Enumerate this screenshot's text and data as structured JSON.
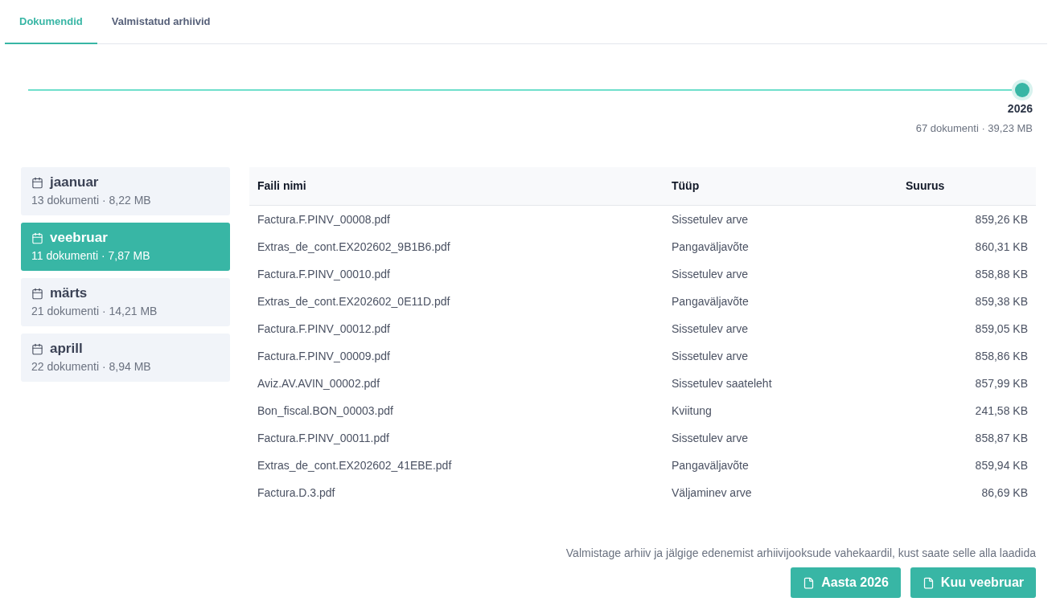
{
  "tabs": [
    {
      "label": "Dokumendid",
      "selected": true
    },
    {
      "label": "Valmistatud arhiivid",
      "selected": false
    }
  ],
  "year_slider": {
    "level": 1,
    "year": "2026",
    "summary": "67 dokumenti · 39,23 MB"
  },
  "months": [
    {
      "name": "jaanuar",
      "summary": "13 dokumenti · 8,22 MB",
      "selected": false
    },
    {
      "name": "veebruar",
      "summary": "11 dokumenti · 7,87 MB",
      "selected": true
    },
    {
      "name": "märts",
      "summary": "21 dokumenti · 14,21 MB",
      "selected": false
    },
    {
      "name": "aprill",
      "summary": "22 dokumenti · 8,94 MB",
      "selected": false
    }
  ],
  "table": {
    "columns": [
      "Faili nimi",
      "Tüüp",
      "Suurus"
    ],
    "rows": [
      [
        "Factura.F.PINV_00008.pdf",
        "Sissetulev arve",
        "859,26 KB"
      ],
      [
        "Extras_de_cont.EX202602_9B1B6.pdf",
        "Pangaväljavõte",
        "860,31 KB"
      ],
      [
        "Factura.F.PINV_00010.pdf",
        "Sissetulev arve",
        "858,88 KB"
      ],
      [
        "Extras_de_cont.EX202602_0E11D.pdf",
        "Pangaväljavõte",
        "859,38 KB"
      ],
      [
        "Factura.F.PINV_00012.pdf",
        "Sissetulev arve",
        "859,05 KB"
      ],
      [
        "Factura.F.PINV_00009.pdf",
        "Sissetulev arve",
        "858,86 KB"
      ],
      [
        "Aviz.AV.AVIN_00002.pdf",
        "Sissetulev saateleht",
        "857,99 KB"
      ],
      [
        "Bon_fiscal.BON_00003.pdf",
        "Kviitung",
        "241,58 KB"
      ],
      [
        "Factura.F.PINV_00011.pdf",
        "Sissetulev arve",
        "858,87 KB"
      ],
      [
        "Extras_de_cont.EX202602_41EBE.pdf",
        "Pangaväljavõte",
        "859,94 KB"
      ],
      [
        "Factura.D.3.pdf",
        "Väljaminev arve",
        "86,69 KB"
      ]
    ]
  },
  "footer": {
    "hint": "Valmistage arhiiv ja jälgige edenemist arhiivijooksude vahekaardil, kust saate selle alla laadida",
    "buttons": [
      "Aasta 2026",
      "Kuu veebruar"
    ]
  }
}
